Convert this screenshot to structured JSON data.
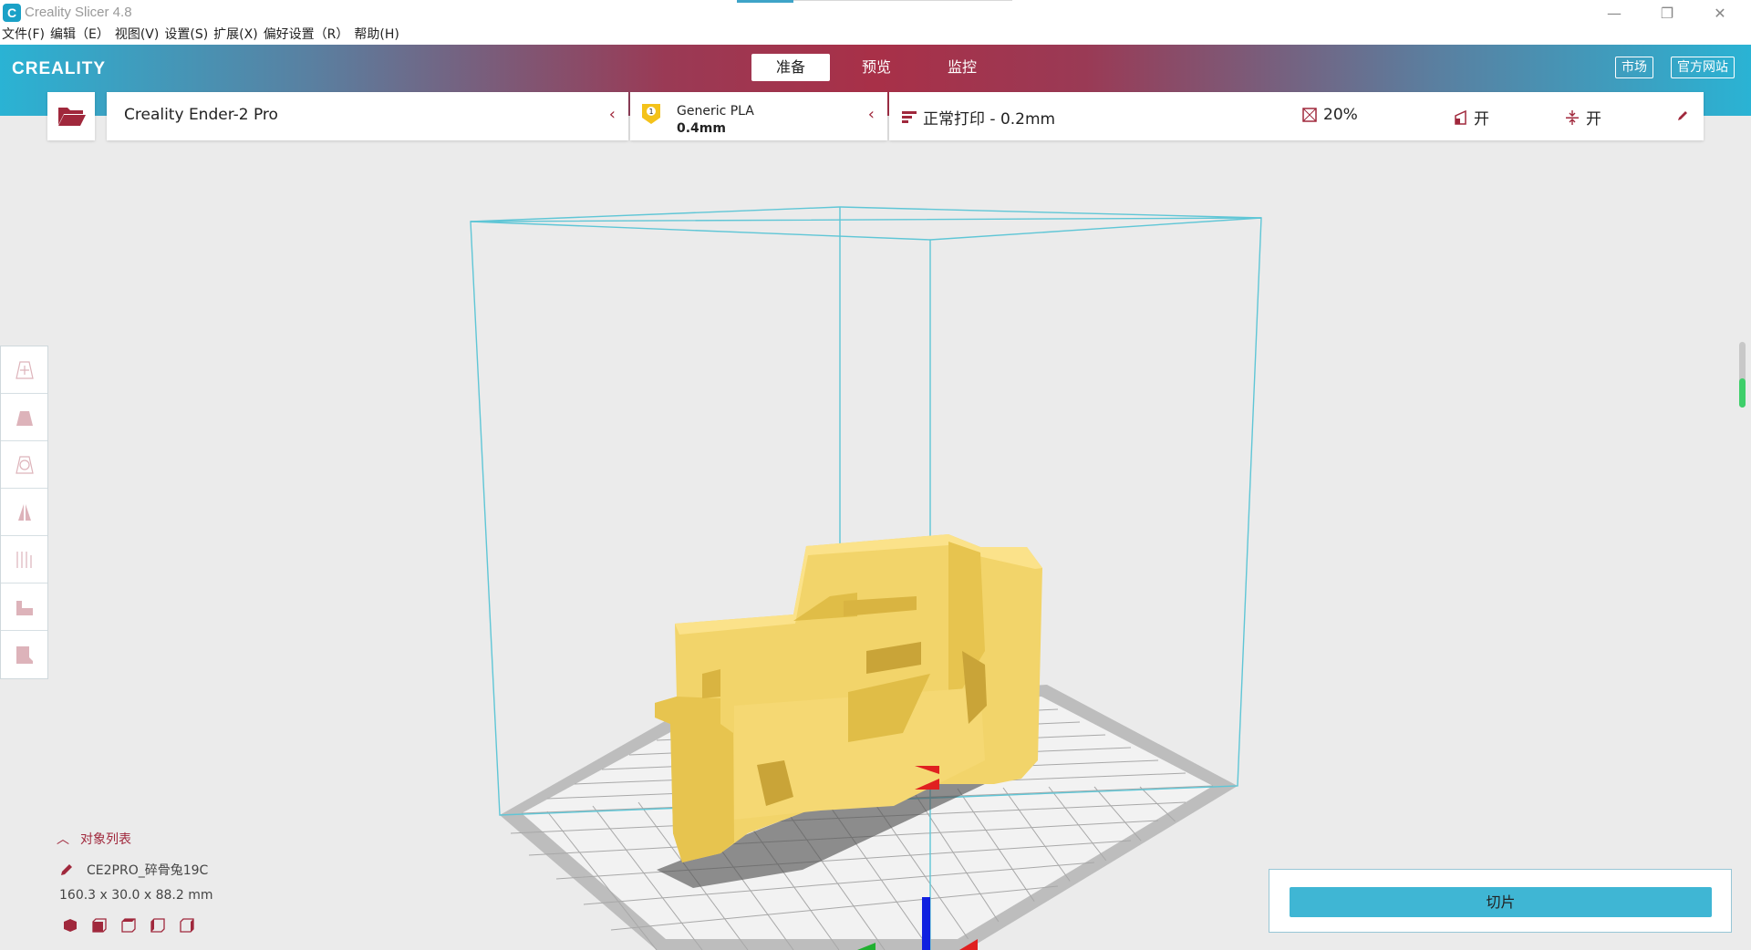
{
  "window": {
    "title": "Creality Slicer 4.8",
    "icon_letter": "C",
    "controls": {
      "minimize": "—",
      "restore": "❐",
      "close": "✕"
    }
  },
  "menu": [
    "文件(F)",
    "编辑（E）",
    "视图(V)",
    "设置(S)",
    "扩展(X)",
    "偏好设置（R）",
    "帮助(H)"
  ],
  "header": {
    "logo": "CREALITY",
    "tabs": [
      {
        "label": "准备",
        "active": true
      },
      {
        "label": "预览",
        "active": false
      },
      {
        "label": "监控",
        "active": false
      }
    ],
    "market_label": "市场",
    "website_label": "官方网站"
  },
  "machine": {
    "name": "Creality Ender-2 Pro"
  },
  "material": {
    "name": "Generic PLA",
    "nozzle": "0.4mm",
    "extruder_number": "1"
  },
  "profile": {
    "quality": "正常打印 - 0.2mm",
    "infill": "20%",
    "support": "开",
    "adhesion": "开"
  },
  "tools": [
    "move-tool-icon",
    "scale-tool-icon",
    "rotate-tool-icon",
    "mirror-tool-icon",
    "per-model-settings-icon",
    "support-blocker-icon",
    "custom-support-icon"
  ],
  "objects": {
    "header": "对象列表",
    "name": "CE2PRO_碎骨兔19C",
    "dimensions": "160.3 x 30.0 x 88.2 mm"
  },
  "scroll_indicator": {
    "level": 0.45
  },
  "colors": {
    "accent": "#a0283c",
    "slice": "#3fb6d4",
    "model": "#f2d46a",
    "volume": "#5fc6d6"
  },
  "slice_button_label": "切片"
}
